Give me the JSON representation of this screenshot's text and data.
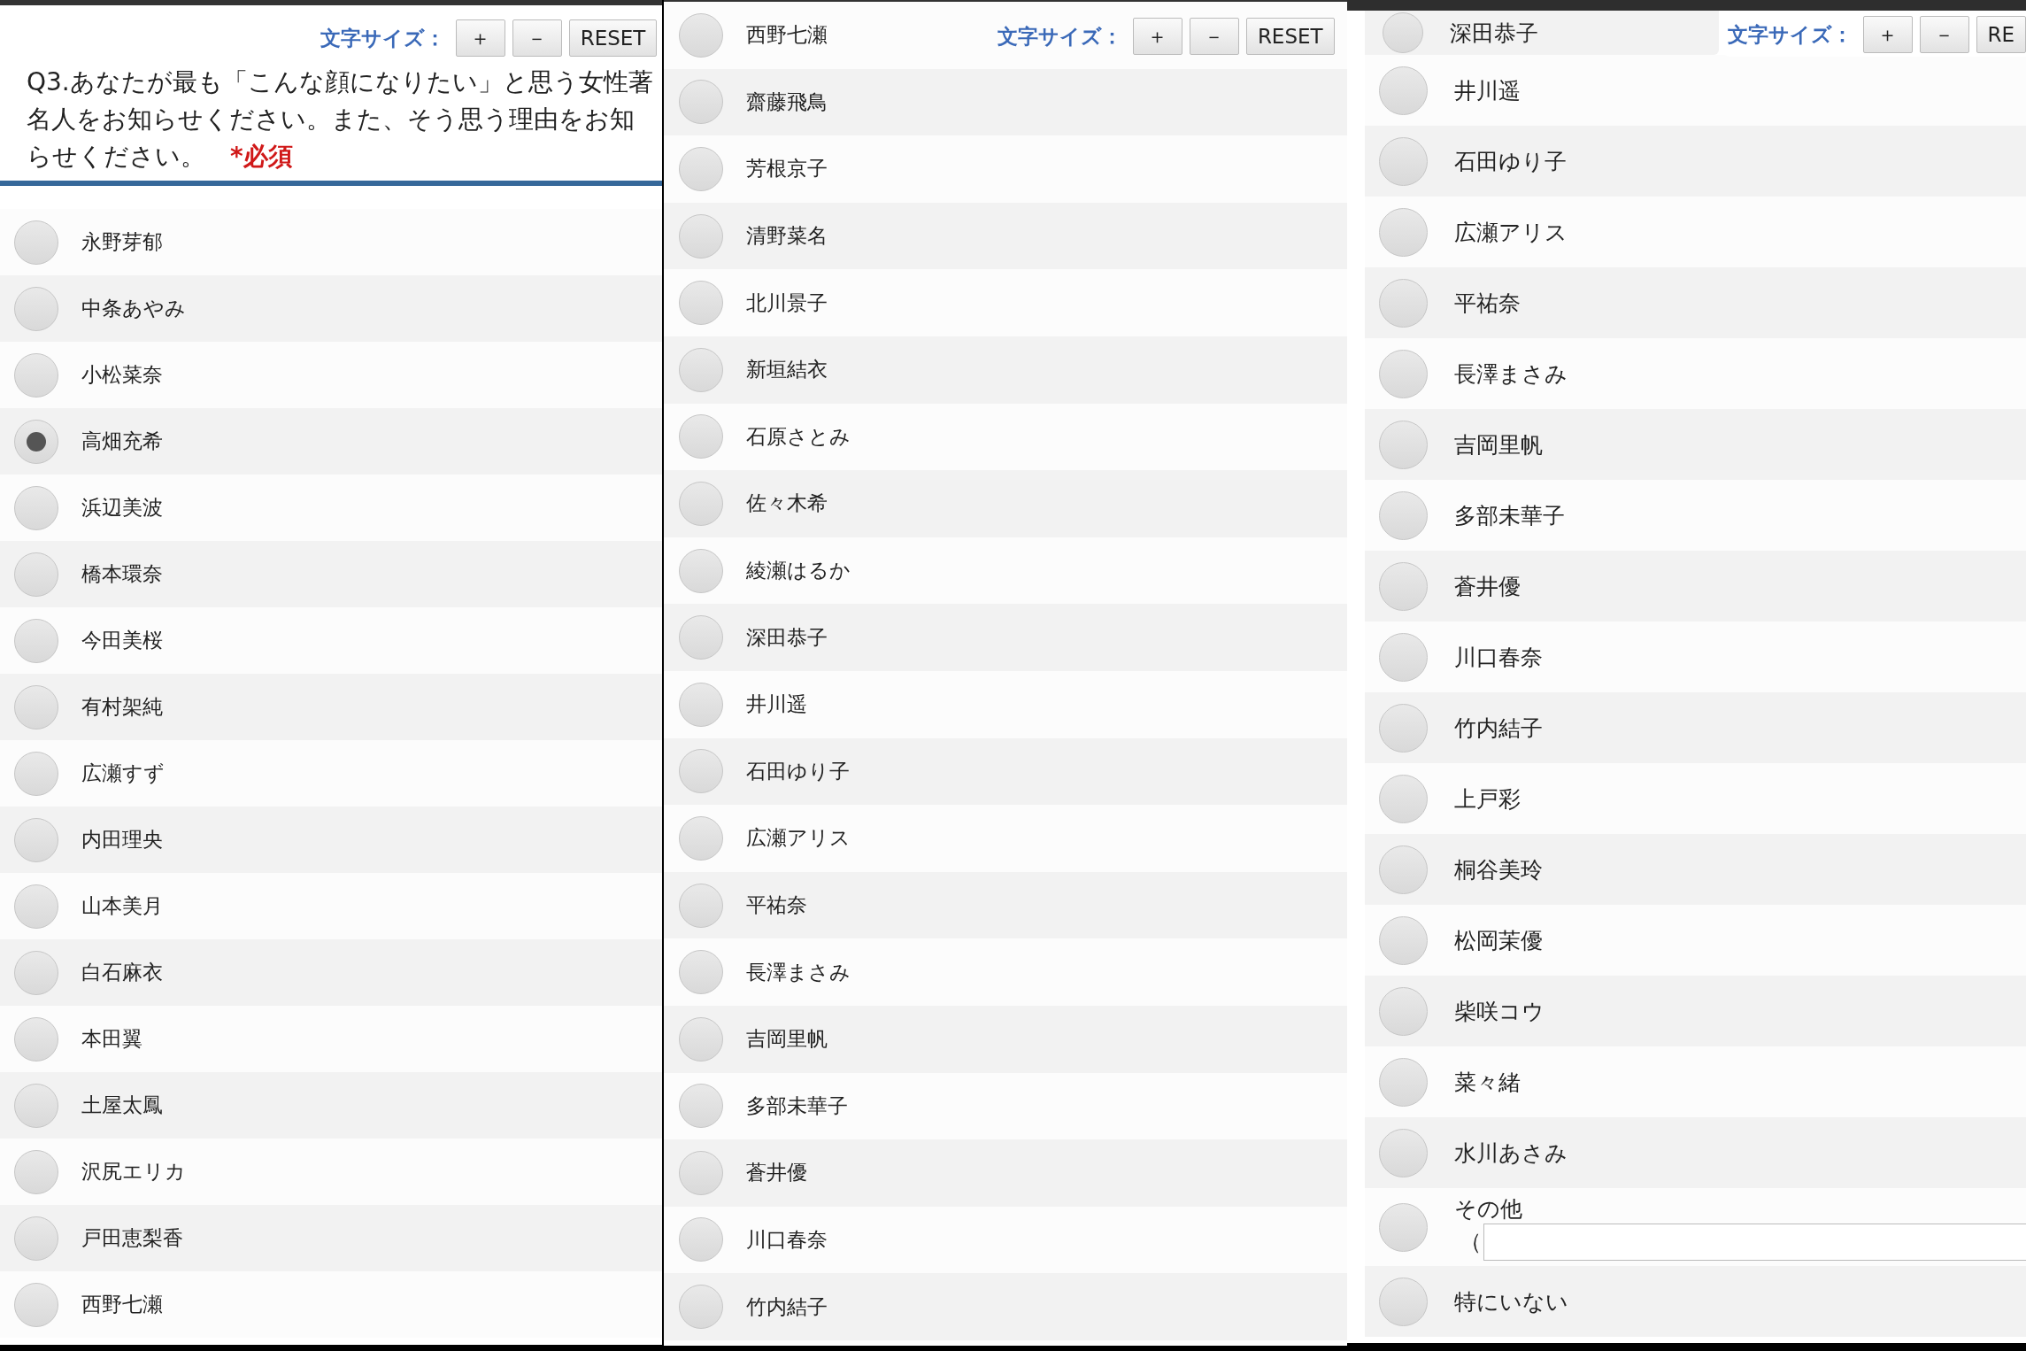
{
  "panels": [
    {
      "toolbar": {
        "label": "文字サイズ：",
        "buttons": [
          "＋",
          "－",
          "RESET"
        ]
      },
      "question": {
        "text": "Q3.あなたが最も「こんな顔になりたい」と思う女性著名人をお知らせください。また、そう思う理由をお知らせください。",
        "required": "*必須"
      },
      "options": [
        {
          "kind": "choice",
          "label": "永野芽郁",
          "selected": false
        },
        {
          "kind": "choice",
          "label": "中条あやみ",
          "selected": false
        },
        {
          "kind": "choice",
          "label": "小松菜奈",
          "selected": false
        },
        {
          "kind": "choice",
          "label": "高畑充希",
          "selected": true
        },
        {
          "kind": "choice",
          "label": "浜辺美波",
          "selected": false
        },
        {
          "kind": "choice",
          "label": "橋本環奈",
          "selected": false
        },
        {
          "kind": "choice",
          "label": "今田美桜",
          "selected": false
        },
        {
          "kind": "choice",
          "label": "有村架純",
          "selected": false
        },
        {
          "kind": "choice",
          "label": "広瀬すず",
          "selected": false
        },
        {
          "kind": "choice",
          "label": "内田理央",
          "selected": false
        },
        {
          "kind": "choice",
          "label": "山本美月",
          "selected": false
        },
        {
          "kind": "choice",
          "label": "白石麻衣",
          "selected": false
        },
        {
          "kind": "choice",
          "label": "本田翼",
          "selected": false
        },
        {
          "kind": "choice",
          "label": "土屋太鳳",
          "selected": false
        },
        {
          "kind": "choice",
          "label": "沢尻エリカ",
          "selected": false
        },
        {
          "kind": "choice",
          "label": "戸田恵梨香",
          "selected": false
        },
        {
          "kind": "choice",
          "label": "西野七瀬",
          "selected": false
        }
      ]
    },
    {
      "toolbar": {
        "label": "文字サイズ：",
        "buttons": [
          "＋",
          "－",
          "RESET"
        ]
      },
      "options": [
        {
          "kind": "choice",
          "label": "西野七瀬",
          "selected": false
        },
        {
          "kind": "choice",
          "label": "齋藤飛鳥",
          "selected": false
        },
        {
          "kind": "choice",
          "label": "芳根京子",
          "selected": false
        },
        {
          "kind": "choice",
          "label": "清野菜名",
          "selected": false
        },
        {
          "kind": "choice",
          "label": "北川景子",
          "selected": false
        },
        {
          "kind": "choice",
          "label": "新垣結衣",
          "selected": false
        },
        {
          "kind": "choice",
          "label": "石原さとみ",
          "selected": false
        },
        {
          "kind": "choice",
          "label": "佐々木希",
          "selected": false
        },
        {
          "kind": "choice",
          "label": "綾瀬はるか",
          "selected": false
        },
        {
          "kind": "choice",
          "label": "深田恭子",
          "selected": false
        },
        {
          "kind": "choice",
          "label": "井川遥",
          "selected": false
        },
        {
          "kind": "choice",
          "label": "石田ゆり子",
          "selected": false
        },
        {
          "kind": "choice",
          "label": "広瀬アリス",
          "selected": false
        },
        {
          "kind": "choice",
          "label": "平祐奈",
          "selected": false
        },
        {
          "kind": "choice",
          "label": "長澤まさみ",
          "selected": false
        },
        {
          "kind": "choice",
          "label": "吉岡里帆",
          "selected": false
        },
        {
          "kind": "choice",
          "label": "多部未華子",
          "selected": false
        },
        {
          "kind": "choice",
          "label": "蒼井優",
          "selected": false
        },
        {
          "kind": "choice",
          "label": "川口春奈",
          "selected": false
        },
        {
          "kind": "choice",
          "label": "竹内結子",
          "selected": false
        }
      ]
    },
    {
      "toolbar": {
        "label": "文字サイズ：",
        "buttons": [
          "＋",
          "－",
          "RE"
        ]
      },
      "options": [
        {
          "kind": "choice",
          "label": "深田恭子",
          "selected": false
        },
        {
          "kind": "choice",
          "label": "井川遥",
          "selected": false
        },
        {
          "kind": "choice",
          "label": "石田ゆり子",
          "selected": false
        },
        {
          "kind": "choice",
          "label": "広瀬アリス",
          "selected": false
        },
        {
          "kind": "choice",
          "label": "平祐奈",
          "selected": false
        },
        {
          "kind": "choice",
          "label": "長澤まさみ",
          "selected": false
        },
        {
          "kind": "choice",
          "label": "吉岡里帆",
          "selected": false
        },
        {
          "kind": "choice",
          "label": "多部未華子",
          "selected": false
        },
        {
          "kind": "choice",
          "label": "蒼井優",
          "selected": false
        },
        {
          "kind": "choice",
          "label": "川口春奈",
          "selected": false
        },
        {
          "kind": "choice",
          "label": "竹内結子",
          "selected": false
        },
        {
          "kind": "choice",
          "label": "上戸彩",
          "selected": false
        },
        {
          "kind": "choice",
          "label": "桐谷美玲",
          "selected": false
        },
        {
          "kind": "choice",
          "label": "松岡茉優",
          "selected": false
        },
        {
          "kind": "choice",
          "label": "柴咲コウ",
          "selected": false
        },
        {
          "kind": "choice",
          "label": "菜々緒",
          "selected": false
        },
        {
          "kind": "choice",
          "label": "水川あさみ",
          "selected": false
        },
        {
          "kind": "other",
          "label": "その他",
          "paren": "（",
          "selected": false
        },
        {
          "kind": "choice",
          "label": "特にいない",
          "selected": false
        }
      ]
    }
  ]
}
